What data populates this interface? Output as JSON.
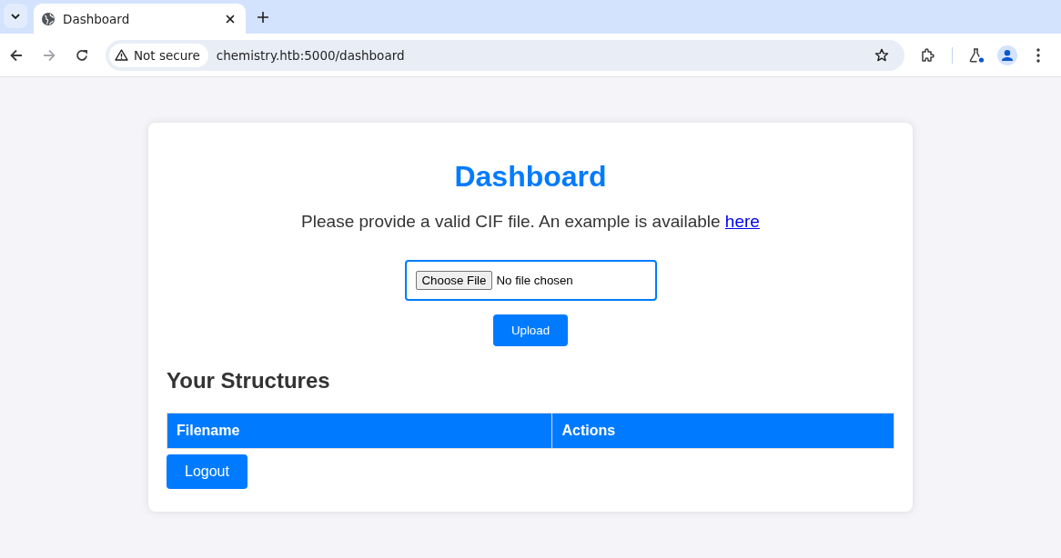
{
  "browser": {
    "tabs": [
      {
        "title": "Dashboard",
        "selected": true
      }
    ],
    "nav_buttons": [
      {
        "kind": "back",
        "disabled": false
      },
      {
        "kind": "forward",
        "disabled": true
      },
      {
        "kind": "reload",
        "disabled": false
      }
    ],
    "address_bar": {
      "security_label": "Not secure",
      "url": "chemistry.htb:5000/dashboard"
    }
  },
  "page": {
    "title": "Dashboard",
    "intro": {
      "text": "Please provide a valid CIF file. An example is available",
      "link": "here"
    },
    "file_input": {
      "button": "Choose File",
      "status": "No file chosen"
    },
    "upload_button": "Upload",
    "structures": {
      "heading": "Your Structures",
      "columns": [
        "Filename",
        "Actions"
      ]
    },
    "logout_button": "Logout"
  }
}
